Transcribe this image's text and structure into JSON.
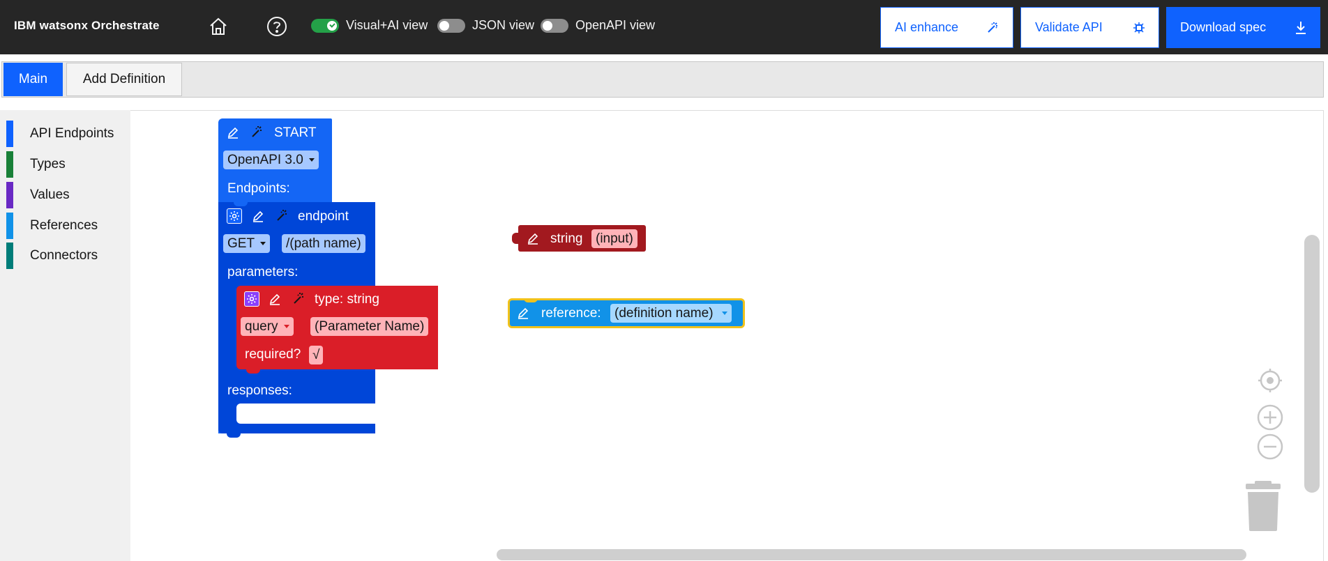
{
  "header": {
    "brand": "IBM watsonx Orchestrate",
    "toggles": [
      {
        "label": "Visual+AI view",
        "on": true
      },
      {
        "label": "JSON view",
        "on": false
      },
      {
        "label": "OpenAPI view",
        "on": false
      }
    ],
    "buttons": {
      "ai_enhance": "AI enhance",
      "validate": "Validate API",
      "download": "Download spec"
    },
    "icons": {
      "home": "home-icon",
      "help": "help-icon",
      "magic_wand": "magic-wand-icon",
      "validate": "validate-icon",
      "download": "download-icon"
    }
  },
  "tabs": [
    {
      "label": "Main",
      "active": true
    },
    {
      "label": "Add Definition",
      "active": false
    }
  ],
  "sidebar": {
    "categories": [
      {
        "label": "API Endpoints",
        "color": "#0f62fe"
      },
      {
        "label": "Types",
        "color": "#198038"
      },
      {
        "label": "Values",
        "color": "#6929c4"
      },
      {
        "label": "References",
        "color": "#1192e8"
      },
      {
        "label": "Connectors",
        "color": "#007d79"
      }
    ]
  },
  "blocks": {
    "start": {
      "title": "START",
      "version_dropdown": "OpenAPI 3.0",
      "endpoints_label": "Endpoints:",
      "color": "#1466f5"
    },
    "endpoint": {
      "title": "endpoint",
      "method_dropdown": "GET",
      "path_field": "/(path name)",
      "parameters_label": "parameters:",
      "responses_label": "responses:",
      "color": "#0046d8"
    },
    "parameter": {
      "title": "type: string",
      "location_dropdown": "query",
      "name_field": "(Parameter Name)",
      "required_label": "required?",
      "required_value": "√",
      "color": "#da1e28"
    },
    "string_value": {
      "title": "string",
      "field": "(input)",
      "color": "#a2191f"
    },
    "reference": {
      "title": "reference:",
      "dropdown": "(definition name)",
      "color": "#1192e8",
      "highlight": "#f1c21b"
    }
  },
  "workspace_controls": {
    "recenter": "recenter-icon",
    "zoom_in": "zoom-in-icon",
    "zoom_out": "zoom-out-icon",
    "trash": "trash-icon"
  }
}
